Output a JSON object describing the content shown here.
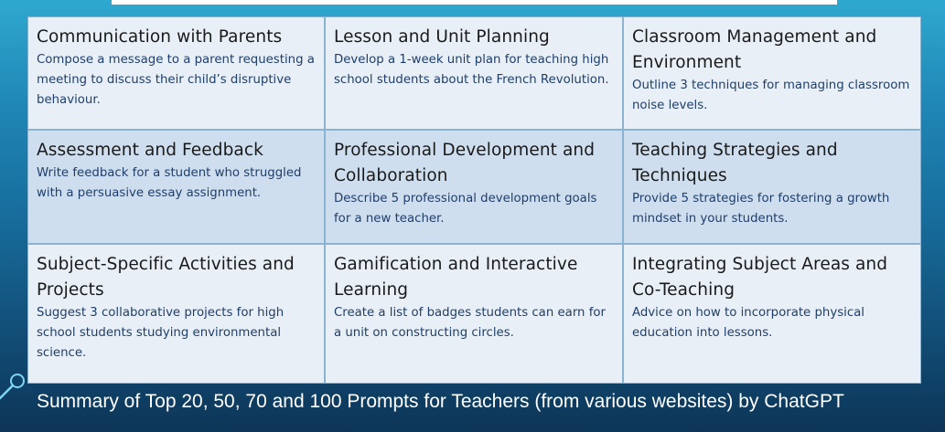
{
  "cards": [
    {
      "title": "Communication with Parents",
      "desc": "Compose a message to a parent requesting a meeting to discuss their child’s disruptive behaviour."
    },
    {
      "title": "Lesson and Unit Planning",
      "desc": "Develop a 1-week unit plan for teaching high school students about the French Revolution."
    },
    {
      "title": "Classroom Management and Environment",
      "desc": "Outline 3 techniques for managing classroom noise levels."
    },
    {
      "title": "Assessment and Feedback",
      "desc": "Write feedback for a student who struggled with a persuasive essay assignment."
    },
    {
      "title": "Professional Development and Collaboration",
      "desc": "Describe 5 professional development goals for a new teacher."
    },
    {
      "title": "Teaching Strategies and Techniques",
      "desc": "Provide 5 strategies for fostering a growth mindset in your students."
    },
    {
      "title": "Subject-Specific Activities and Projects",
      "desc": "Suggest 3 collaborative projects for high school students studying environmental science."
    },
    {
      "title": "Gamification and Interactive Learning",
      "desc": "Create a list of badges students can earn for a unit on constructing circles."
    },
    {
      "title": "Integrating Subject Areas and Co-Teaching",
      "desc": "Advice on how to incorporate physical education into lessons."
    }
  ],
  "caption": "Summary of Top 20, 50, 70 and 100 Prompts for Teachers (from various websites) by ChatGPT",
  "icons": {
    "decoration": "magnifier-icon"
  },
  "colors": {
    "row_light": "#e9eff7",
    "row_dark": "#cfdeee",
    "grid_line": "#8ab3d1",
    "title_text": "#1a1a1a",
    "desc_text": "#1f3f6a",
    "caption_text": "#ffffff"
  }
}
